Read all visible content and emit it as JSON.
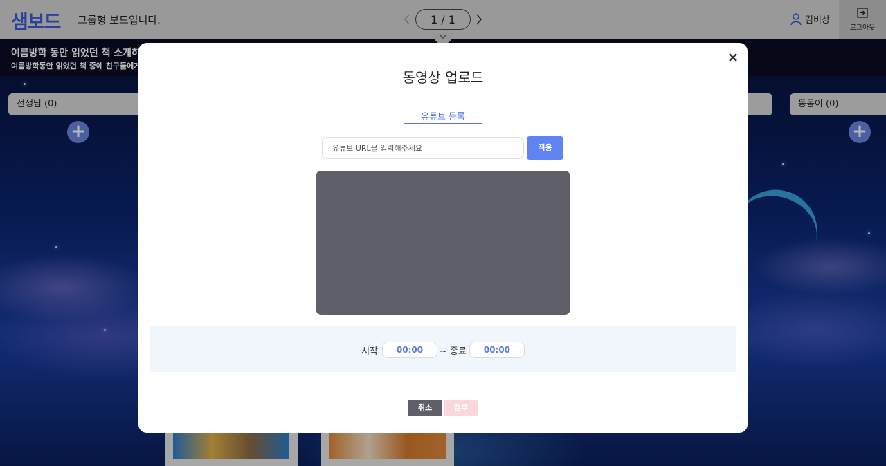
{
  "header": {
    "logo": "샘보드",
    "board_title": "그룹형 보드입니다.",
    "pager": {
      "current": "1 / 1"
    },
    "user_name": "김비상",
    "logout_label": "로그아웃"
  },
  "board_info": {
    "title": "여름방학 동안 읽었던 책 소개하",
    "description": "여름방학동안 읽었던 책 중에 친구들에게"
  },
  "columns": [
    {
      "header": "선생님 (0)"
    },
    {
      "header": "동동이 (0)"
    }
  ],
  "modal": {
    "title": "동영상 업로드",
    "tab_label": "유튜브 등록",
    "url_placeholder": "유튜브 URL을 입력해주세요",
    "apply_label": "적용",
    "start_label": "시작",
    "start_time": "00:00",
    "end_label": "~ 종료",
    "end_time": "00:00",
    "cancel_label": "취소",
    "attach_label": "첨부"
  },
  "colors": {
    "accent": "#5f84f2",
    "logo": "#3b5bd6",
    "video_preview": "#5f5f69",
    "attach_disabled": "#f9d7dc"
  }
}
